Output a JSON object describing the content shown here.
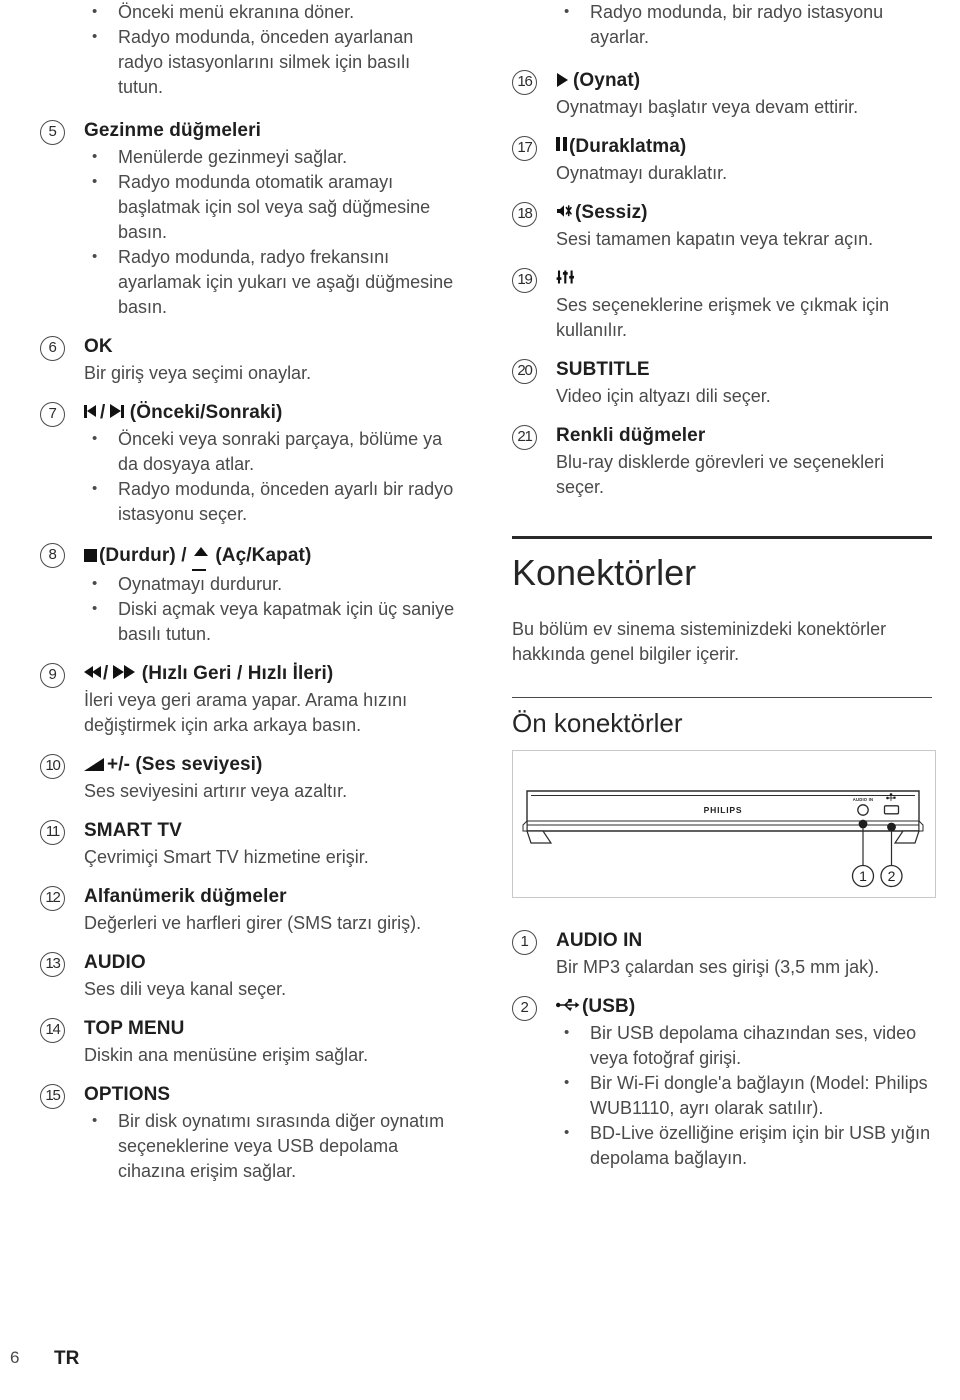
{
  "document": {
    "footer": {
      "page_number": "6",
      "language_code": "TR"
    }
  },
  "left_column": {
    "orphan_bullets": [
      "Önceki menü ekranına döner.",
      "Radyo modunda, önceden ayarlanan radyo istasyonlarını silmek için basılı tutun."
    ],
    "entries": [
      {
        "num": "5",
        "title": "Gezinme düğmeleri",
        "icon": "",
        "desc": "",
        "bullets": [
          "Menülerde gezinmeyi sağlar.",
          "Radyo modunda otomatik aramayı başlatmak için sol veya sağ düğmesine basın.",
          "Radyo modunda, radyo frekansını ayarlamak için yukarı ve aşağı düğmesine basın."
        ]
      },
      {
        "num": "6",
        "title": "OK",
        "icon": "",
        "desc": "Bir giriş veya seçimi onaylar.",
        "bullets": []
      },
      {
        "num": "7",
        "title": "(Önceki/Sonraki)",
        "icon": "prev-next-icon",
        "desc": "",
        "bullets": [
          "Önceki veya sonraki parçaya, bölüme ya da dosyaya atlar.",
          "Radyo modunda, önceden ayarlı bir radyo istasyonu seçer."
        ]
      },
      {
        "num": "8",
        "title_parts": {
          "stop": "(Durdur)",
          "sep": "/",
          "eject": "(Aç/Kapat)"
        },
        "icon": "stop-eject-icon",
        "desc": "",
        "bullets": [
          "Oynatmayı durdurur.",
          "Diski açmak veya kapatmak için üç saniye basılı tutun."
        ]
      },
      {
        "num": "9",
        "title": "(Hızlı Geri / Hızlı İleri)",
        "icon": "rewind-forward-icon",
        "desc": "İleri veya geri arama yapar. Arama hızını değiştirmek için arka arkaya basın.",
        "bullets": []
      },
      {
        "num": "10",
        "title": "+/- (Ses seviyesi)",
        "icon": "volume-icon",
        "desc": "Ses seviyesini artırır veya azaltır.",
        "bullets": []
      },
      {
        "num": "11",
        "title": "SMART TV",
        "icon": "",
        "desc": "Çevrimiçi Smart TV hizmetine erişir.",
        "bullets": []
      },
      {
        "num": "12",
        "title": "Alfanümerik düğmeler",
        "icon": "",
        "desc": "Değerleri ve harfleri girer (SMS tarzı giriş).",
        "bullets": []
      },
      {
        "num": "13",
        "title": "AUDIO",
        "icon": "",
        "desc": "Ses dili veya kanal seçer.",
        "bullets": []
      },
      {
        "num": "14",
        "title": "TOP MENU",
        "icon": "",
        "desc": "Diskin ana menüsüne erişim sağlar.",
        "bullets": []
      },
      {
        "num": "15",
        "title": "OPTIONS",
        "icon": "",
        "desc": "",
        "bullets": [
          "Bir disk oynatımı sırasında diğer oynatım seçeneklerine veya USB depolama cihazına erişim sağlar."
        ]
      }
    ]
  },
  "right_column": {
    "orphan_bullets": [
      "Radyo modunda, bir radyo istasyonu ayarlar."
    ],
    "entries": [
      {
        "num": "16",
        "title": "(Oynat)",
        "icon": "play-icon",
        "desc": "Oynatmayı başlatır veya devam ettirir.",
        "bullets": []
      },
      {
        "num": "17",
        "title": "(Duraklatma)",
        "icon": "pause-icon",
        "desc": "Oynatmayı duraklatır.",
        "bullets": []
      },
      {
        "num": "18",
        "title": "(Sessiz)",
        "icon": "mute-icon",
        "desc": "Sesi tamamen kapatın veya tekrar açın.",
        "bullets": []
      },
      {
        "num": "19",
        "title": "",
        "icon": "sound-settings-icon",
        "desc": "Ses seçeneklerine erişmek ve çıkmak için kullanılır.",
        "bullets": []
      },
      {
        "num": "20",
        "title": "SUBTITLE",
        "icon": "",
        "desc": "Video için altyazı dili seçer.",
        "bullets": []
      },
      {
        "num": "21",
        "title": "Renkli düğmeler",
        "icon": "",
        "desc": "Blu-ray disklerde görevleri ve seçenekleri seçer.",
        "bullets": []
      }
    ],
    "section": {
      "heading": "Konektörler",
      "body": "Bu bölüm ev sinema sisteminizdeki konektörler hakkında genel bilgiler içerir.",
      "subheading": "Ön konektörler"
    },
    "figure": {
      "brand_label": "PHILIPS",
      "connector_labels": {
        "audio_in": "AUDIO IN",
        "usb": "USB"
      },
      "callouts": [
        "1",
        "2"
      ]
    },
    "connector_entries": [
      {
        "num": "1",
        "title": "AUDIO IN",
        "icon": "",
        "desc": "Bir MP3 çalardan ses girişi (3,5 mm jak).",
        "bullets": []
      },
      {
        "num": "2",
        "title": "(USB)",
        "icon": "usb-icon",
        "desc": "",
        "bullets": [
          "Bir USB depolama cihazından ses, video veya fotoğraf girişi.",
          "Bir Wi-Fi dongle'a bağlayın (Model: Philips WUB1110, ayrı olarak satılır).",
          "BD-Live özelliğine erişim için bir USB yığın depolama bağlayın."
        ]
      }
    ]
  },
  "colors": {
    "text": "#4a4a4a",
    "heading": "#262626",
    "rule": "#2a2a2a",
    "figure_border": "#c9c9c9"
  }
}
